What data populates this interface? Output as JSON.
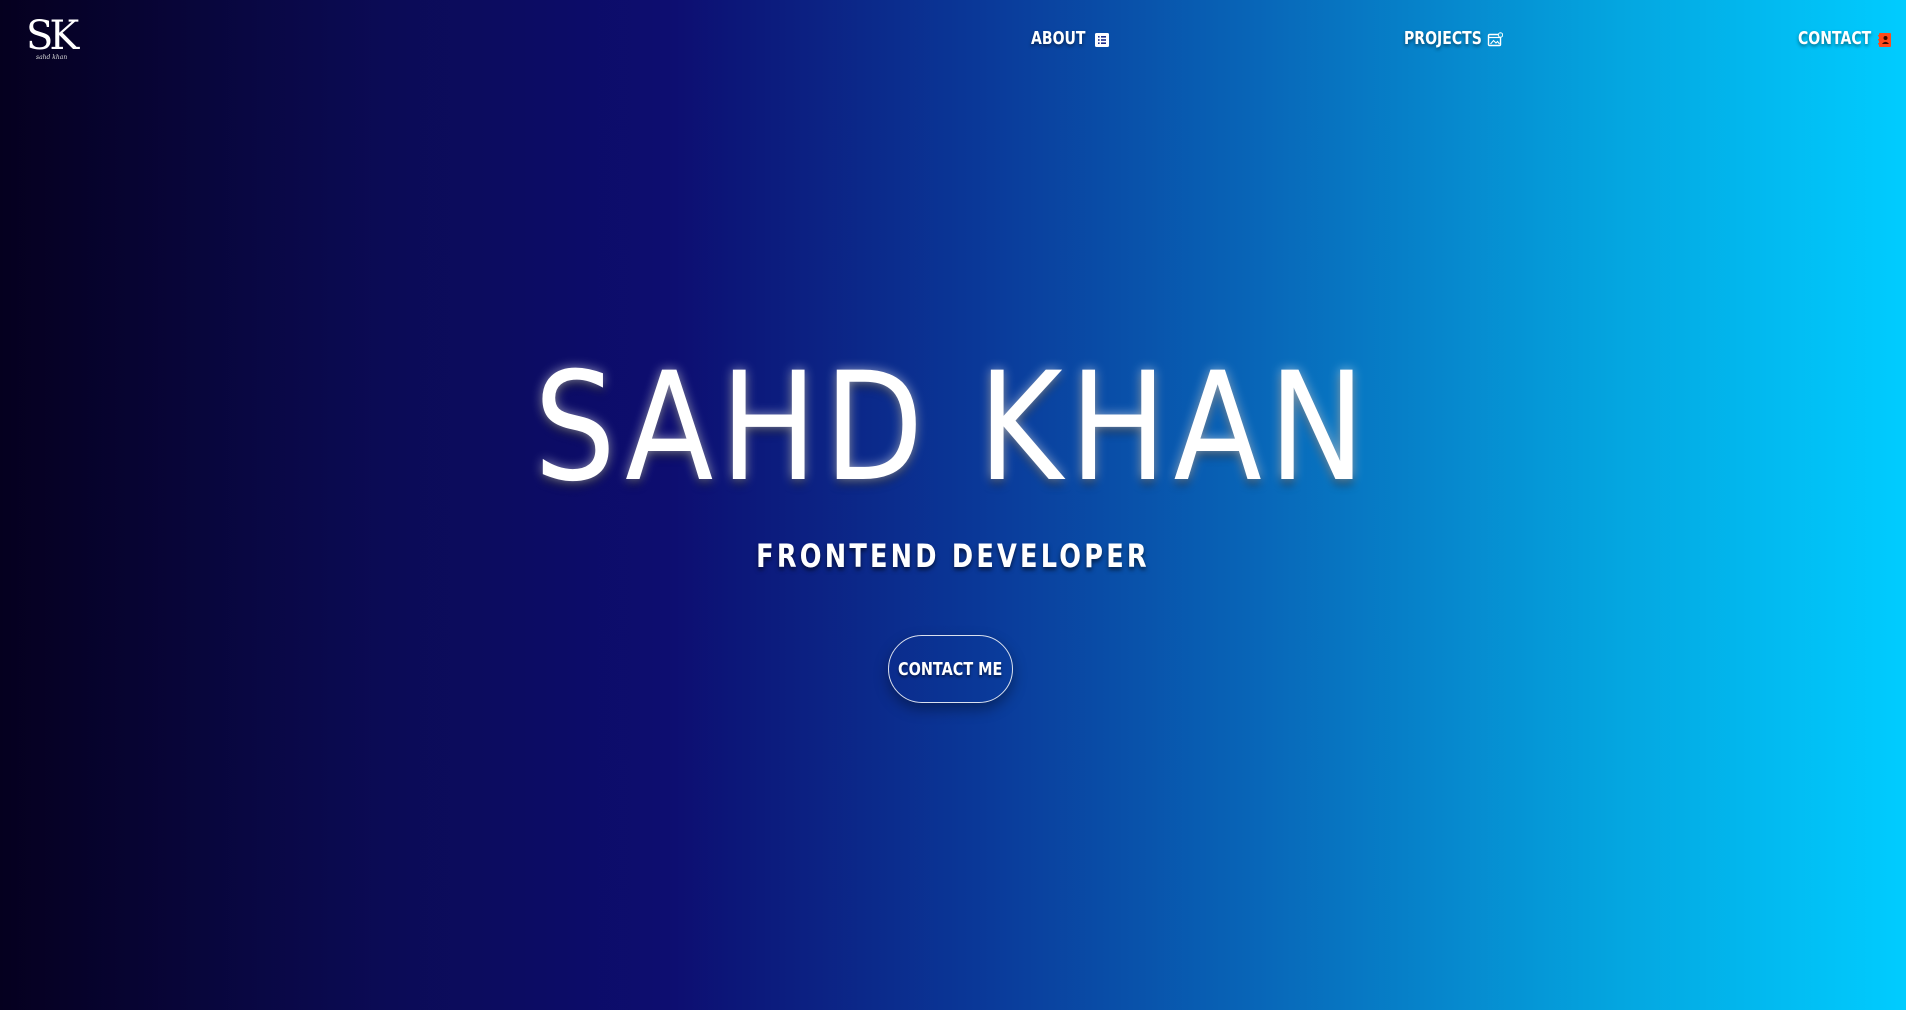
{
  "brand": {
    "monogram": "SK",
    "signature": "sahd khan",
    "logo_icon": "sk-monogram-logo"
  },
  "nav": {
    "items": [
      {
        "label": "ABOUT",
        "icon": "list-document-icon"
      },
      {
        "label": "PROJECTS",
        "icon": "calendar-image-icon"
      },
      {
        "label": "CONTACT",
        "icon": "contact-book-icon",
        "icon_color": "#ff4a1a"
      }
    ]
  },
  "hero": {
    "name": "SAHD KHAN",
    "role": "FRONTEND DEVELOPER",
    "cta_label": "CONTACT ME"
  },
  "colors": {
    "gradient_start": "#05001f",
    "gradient_mid": "#0d0d70",
    "gradient_end": "#00ccff",
    "text": "#ffffff",
    "contact_icon": "#ff4a1a"
  }
}
